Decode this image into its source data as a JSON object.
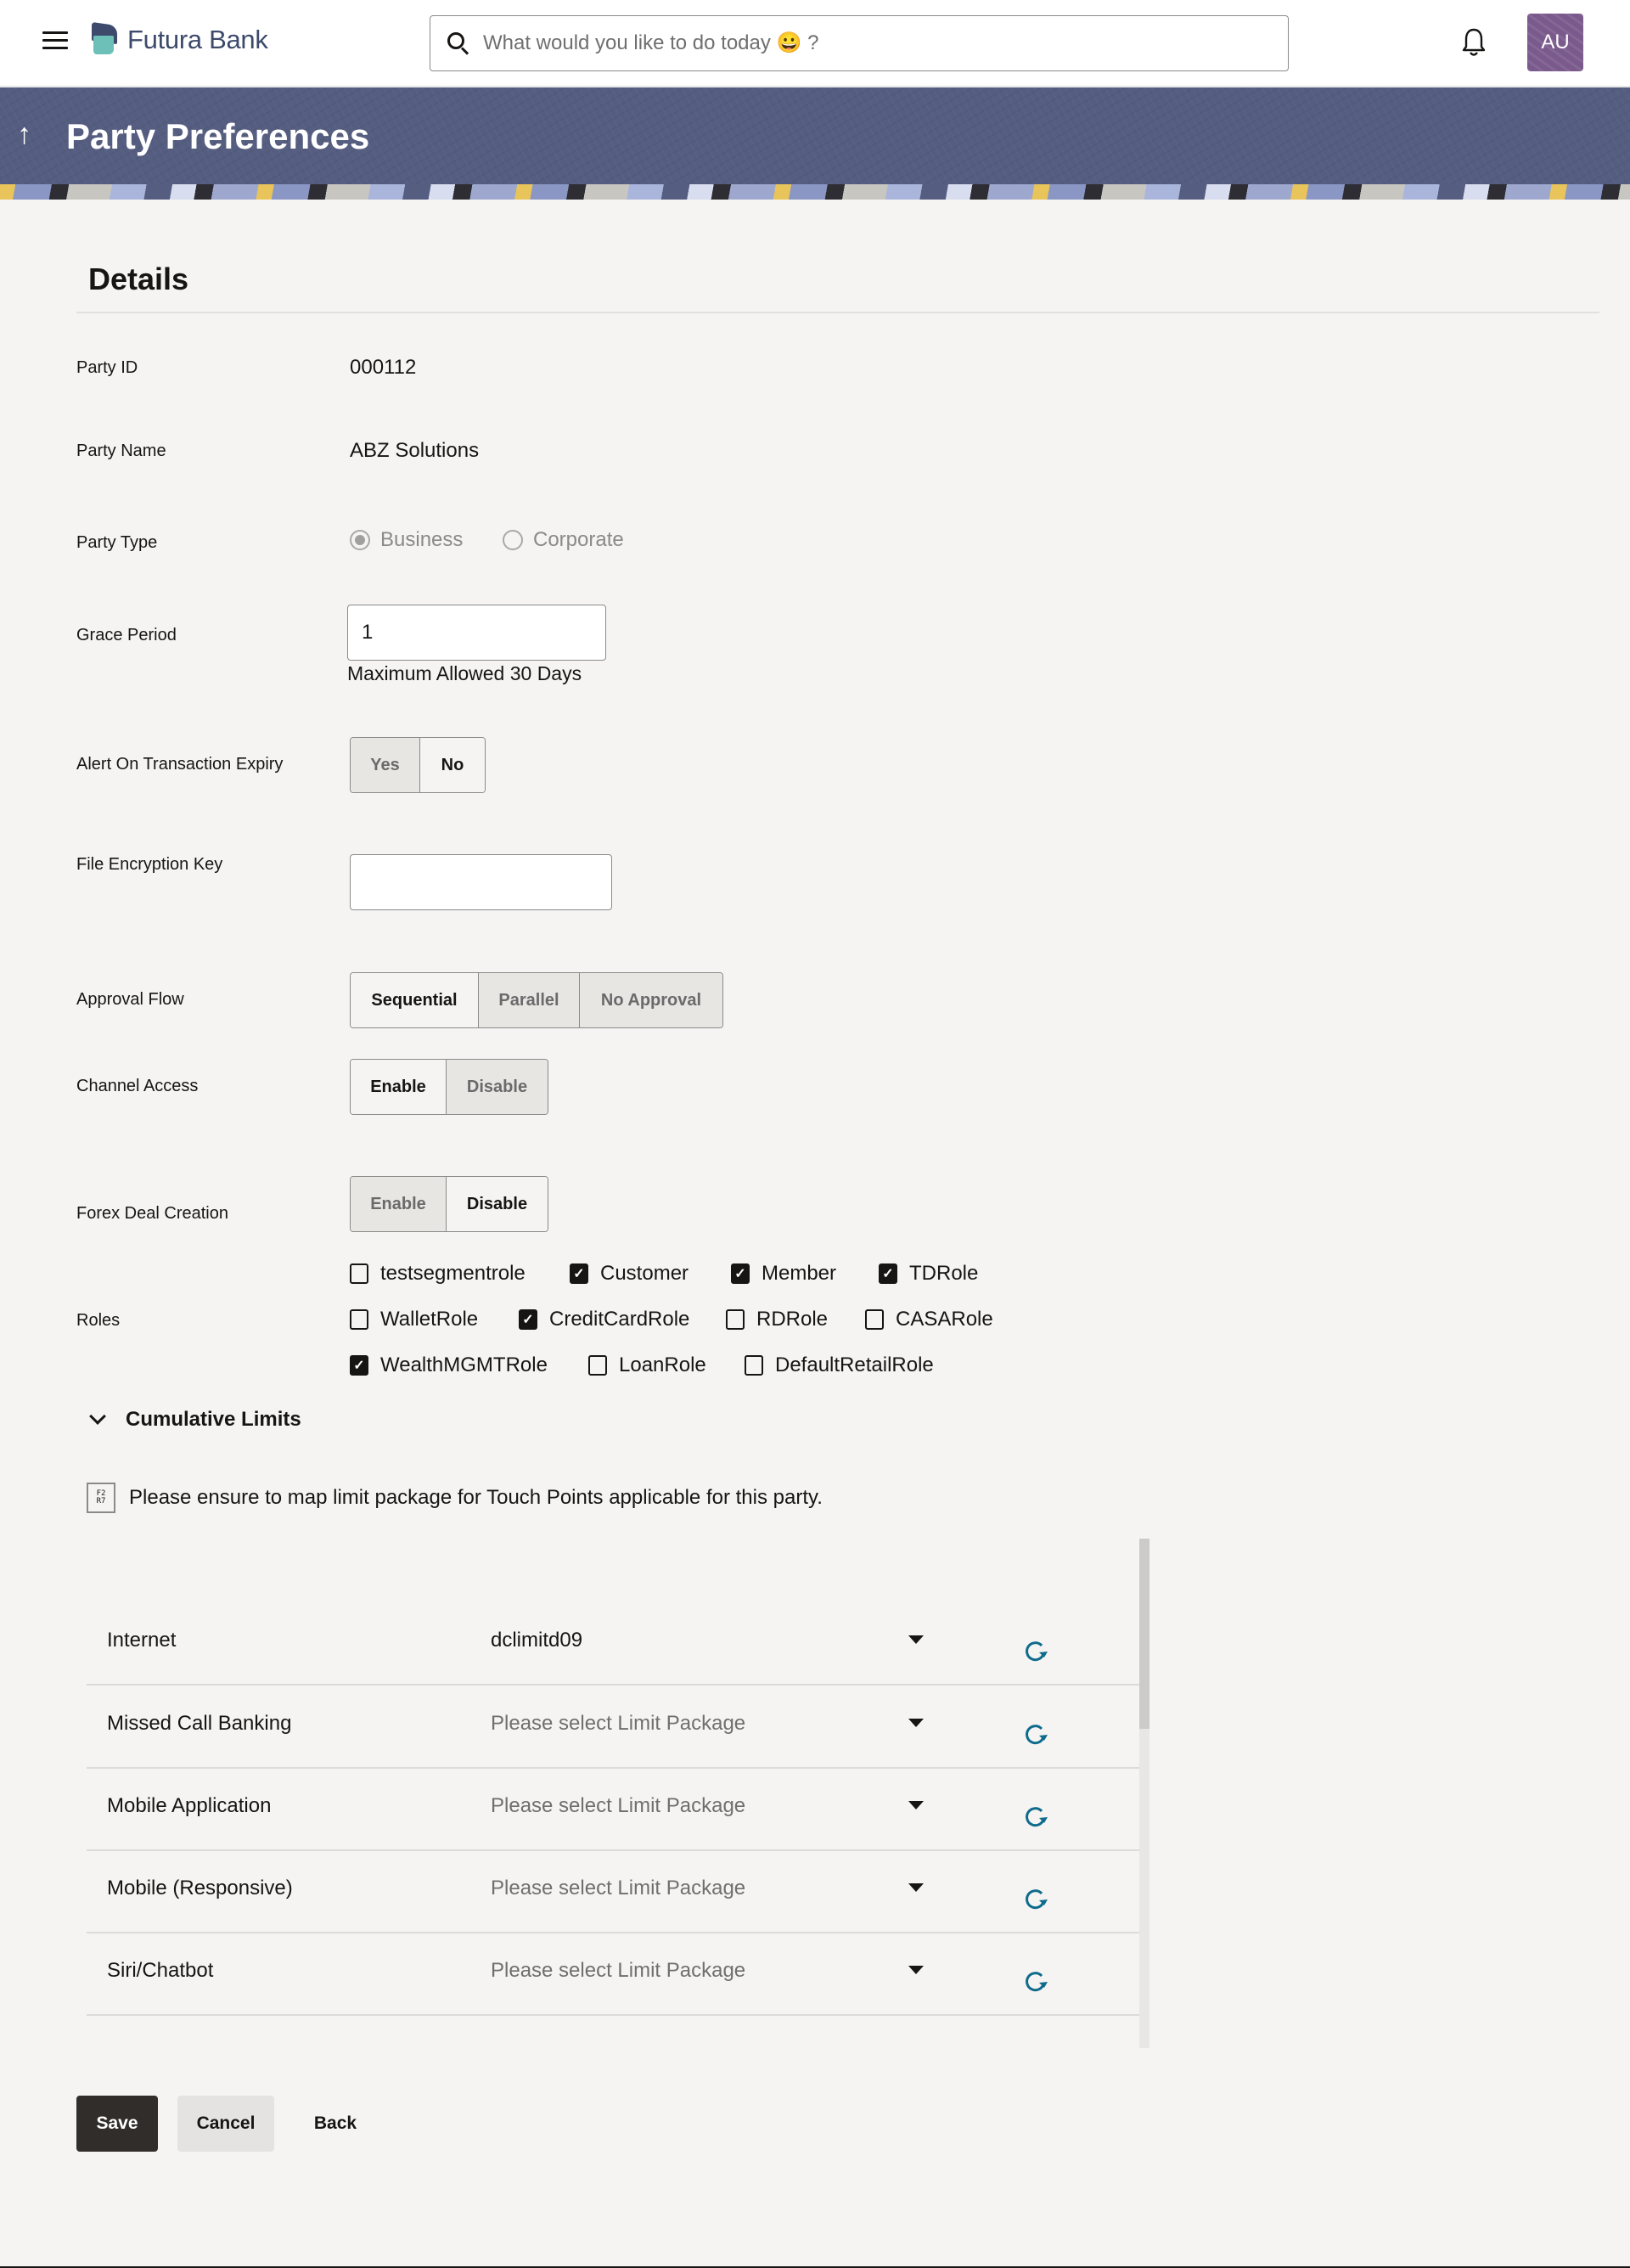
{
  "header": {
    "brand": "Futura Bank",
    "search_placeholder": "What would you like to do today 😀 ?",
    "avatar_initials": "AU"
  },
  "banner": {
    "title": "Party Preferences",
    "back_arrow": "↑"
  },
  "details": {
    "section_title": "Details",
    "party_id": {
      "label": "Party ID",
      "value": "000112"
    },
    "party_name": {
      "label": "Party Name",
      "value": "ABZ Solutions"
    },
    "party_type": {
      "label": "Party Type",
      "options": [
        {
          "label": "Business",
          "selected": true
        },
        {
          "label": "Corporate",
          "selected": false
        }
      ]
    },
    "grace_period": {
      "label": "Grace Period",
      "value": "1",
      "helper": "Maximum Allowed 30 Days"
    },
    "alert_on_expiry": {
      "label": "Alert On Transaction Expiry",
      "options": [
        {
          "label": "Yes",
          "selected": false
        },
        {
          "label": "No",
          "selected": true
        }
      ]
    },
    "file_encryption_key": {
      "label": "File Encryption Key",
      "value": ""
    },
    "approval_flow": {
      "label": "Approval Flow",
      "options": [
        {
          "label": "Sequential",
          "selected": true
        },
        {
          "label": "Parallel",
          "selected": false
        },
        {
          "label": "No Approval",
          "selected": false
        }
      ]
    },
    "channel_access": {
      "label": "Channel Access",
      "options": [
        {
          "label": "Enable",
          "selected": true
        },
        {
          "label": "Disable",
          "selected": false
        }
      ]
    },
    "forex_deal_creation": {
      "label": "Forex Deal Creation",
      "options": [
        {
          "label": "Enable",
          "selected": false
        },
        {
          "label": "Disable",
          "selected": true
        }
      ]
    },
    "roles": {
      "label": "Roles",
      "items": [
        {
          "label": "testsegmentrole",
          "checked": false
        },
        {
          "label": "Customer",
          "checked": true
        },
        {
          "label": "Member",
          "checked": true
        },
        {
          "label": "TDRole",
          "checked": true
        },
        {
          "label": "WalletRole",
          "checked": false
        },
        {
          "label": "CreditCardRole",
          "checked": true
        },
        {
          "label": "RDRole",
          "checked": false
        },
        {
          "label": "CASARole",
          "checked": false
        },
        {
          "label": "WealthMGMTRole",
          "checked": true
        },
        {
          "label": "LoanRole",
          "checked": false
        },
        {
          "label": "DefaultRetailRole",
          "checked": false
        }
      ]
    }
  },
  "cumulative_limits": {
    "title": "Cumulative Limits",
    "info_icon_text": "F2 R7",
    "info_message": "Please ensure to map limit package for Touch Points applicable for this party.",
    "rows": [
      {
        "touch_point": "Internet",
        "package": "dclimitd09",
        "is_placeholder": false
      },
      {
        "touch_point": "Missed Call Banking",
        "package": "Please select Limit Package",
        "is_placeholder": true
      },
      {
        "touch_point": "Mobile Application",
        "package": "Please select Limit Package",
        "is_placeholder": true
      },
      {
        "touch_point": "Mobile (Responsive)",
        "package": "Please select Limit Package",
        "is_placeholder": true
      },
      {
        "touch_point": "Siri/Chatbot",
        "package": "Please select Limit Package",
        "is_placeholder": true
      }
    ]
  },
  "actions": {
    "save": "Save",
    "cancel": "Cancel",
    "back": "Back"
  },
  "colors": {
    "banner": "#555d80",
    "primary_button": "#312d2a",
    "reset_icon": "#0f6b8c",
    "avatar": "#7a5a8c",
    "brand_text": "#3d4a6b",
    "brand_mark_accent": "#6cc0b8"
  }
}
